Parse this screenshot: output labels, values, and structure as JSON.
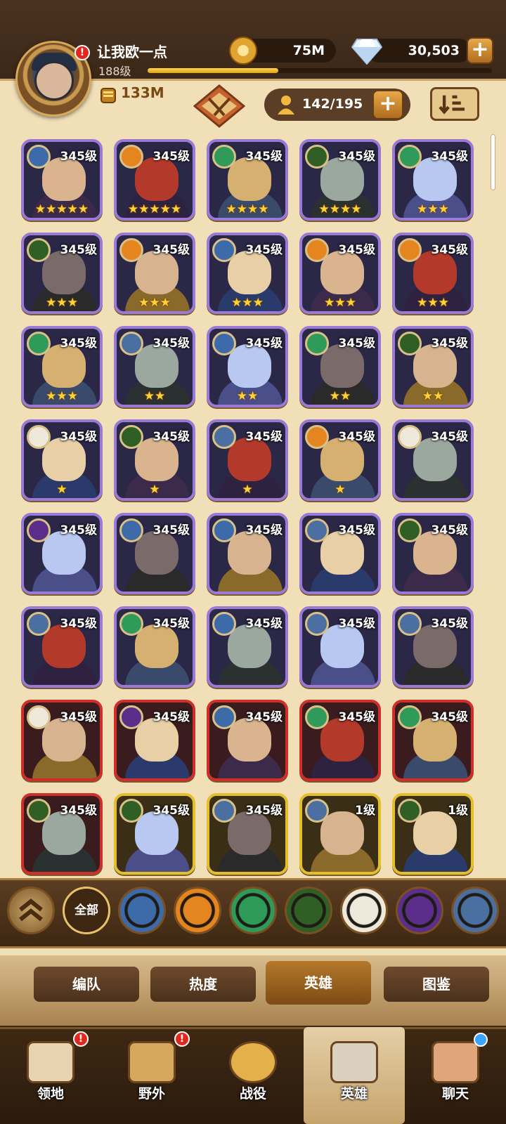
{
  "player": {
    "name": "让我欧一点",
    "level": "188级",
    "power": "133M",
    "xp_progress": 0.38
  },
  "currencies": {
    "gold": "75M",
    "diamonds": "30,503"
  },
  "hero_count": "142/195",
  "colors": {
    "purple_frame": "#9a7ad6",
    "red_frame": "#cf2f2a",
    "gold_frame": "#e3bf2c",
    "star": "#ffd23a"
  },
  "heroes": [
    {
      "level": "345级",
      "stars": "★★★★★",
      "faction": "lightbearer",
      "frame": "purple"
    },
    {
      "level": "345级",
      "stars": "★★★★★",
      "faction": "mauler",
      "frame": "purple"
    },
    {
      "level": "345级",
      "stars": "★★★★",
      "faction": "wilder",
      "frame": "purple"
    },
    {
      "level": "345级",
      "stars": "★★★★",
      "faction": "graveborn",
      "frame": "purple"
    },
    {
      "level": "345级",
      "stars": "★★★",
      "faction": "wilder",
      "frame": "purple"
    },
    {
      "level": "345级",
      "stars": "★★★",
      "faction": "graveborn",
      "frame": "purple"
    },
    {
      "level": "345级",
      "stars": "★★★",
      "faction": "mauler",
      "frame": "purple"
    },
    {
      "level": "345级",
      "stars": "★★★",
      "faction": "lightbearer",
      "frame": "purple"
    },
    {
      "level": "345级",
      "stars": "★★★",
      "faction": "mauler",
      "frame": "purple"
    },
    {
      "level": "345级",
      "stars": "★★★",
      "faction": "mauler",
      "frame": "purple"
    },
    {
      "level": "345级",
      "stars": "★★★",
      "faction": "wilder",
      "frame": "purple"
    },
    {
      "level": "345级",
      "stars": "★★",
      "faction": "dimensional",
      "frame": "purple"
    },
    {
      "level": "345级",
      "stars": "★★",
      "faction": "lightbearer",
      "frame": "purple"
    },
    {
      "level": "345级",
      "stars": "★★",
      "faction": "wilder",
      "frame": "purple"
    },
    {
      "level": "345级",
      "stars": "★★",
      "faction": "graveborn",
      "frame": "purple"
    },
    {
      "level": "345级",
      "stars": "★",
      "faction": "celestial",
      "frame": "purple"
    },
    {
      "level": "345级",
      "stars": "★",
      "faction": "graveborn",
      "frame": "purple"
    },
    {
      "level": "345级",
      "stars": "★",
      "faction": "dimensional",
      "frame": "purple"
    },
    {
      "level": "345级",
      "stars": "★",
      "faction": "mauler",
      "frame": "purple"
    },
    {
      "level": "345级",
      "stars": "",
      "faction": "celestial",
      "frame": "purple"
    },
    {
      "level": "345级",
      "stars": "",
      "faction": "hypogean",
      "frame": "purple"
    },
    {
      "level": "345级",
      "stars": "",
      "faction": "lightbearer",
      "frame": "purple"
    },
    {
      "level": "345级",
      "stars": "",
      "faction": "lightbearer",
      "frame": "purple"
    },
    {
      "level": "345级",
      "stars": "",
      "faction": "dimensional",
      "frame": "purple"
    },
    {
      "level": "345级",
      "stars": "",
      "faction": "graveborn",
      "frame": "purple"
    },
    {
      "level": "345级",
      "stars": "",
      "faction": "dimensional",
      "frame": "purple"
    },
    {
      "level": "345级",
      "stars": "",
      "faction": "wilder",
      "frame": "purple"
    },
    {
      "level": "345级",
      "stars": "",
      "faction": "lightbearer",
      "frame": "purple"
    },
    {
      "level": "345级",
      "stars": "",
      "faction": "dimensional",
      "frame": "purple"
    },
    {
      "level": "345级",
      "stars": "",
      "faction": "dimensional",
      "frame": "purple"
    },
    {
      "level": "345级",
      "stars": "",
      "faction": "celestial",
      "frame": "red"
    },
    {
      "level": "345级",
      "stars": "",
      "faction": "hypogean",
      "frame": "red"
    },
    {
      "level": "345级",
      "stars": "",
      "faction": "lightbearer",
      "frame": "red"
    },
    {
      "level": "345级",
      "stars": "",
      "faction": "wilder",
      "frame": "red"
    },
    {
      "level": "345级",
      "stars": "",
      "faction": "wilder",
      "frame": "red"
    },
    {
      "level": "345级",
      "stars": "",
      "faction": "graveborn",
      "frame": "red"
    },
    {
      "level": "345级",
      "stars": "",
      "faction": "graveborn",
      "frame": "gold"
    },
    {
      "level": "345级",
      "stars": "",
      "faction": "dimensional",
      "frame": "gold"
    },
    {
      "level": "1级",
      "stars": "",
      "faction": "dimensional",
      "frame": "gold"
    },
    {
      "level": "1级",
      "stars": "",
      "faction": "graveborn",
      "frame": "gold"
    }
  ],
  "filters": [
    {
      "label": "",
      "icon": "collapse-up-icon"
    },
    {
      "label": "全部",
      "icon": "all-factions"
    },
    {
      "label": "",
      "icon": "lightbearer-icon",
      "color": "#3d6aa8"
    },
    {
      "label": "",
      "icon": "mauler-icon",
      "color": "#e5851f"
    },
    {
      "label": "",
      "icon": "wilder-icon",
      "color": "#2f9a5a"
    },
    {
      "label": "",
      "icon": "graveborn-icon",
      "color": "#2f5f25"
    },
    {
      "label": "",
      "icon": "celestial-icon",
      "color": "#efe9dc"
    },
    {
      "label": "",
      "icon": "hypogean-icon",
      "color": "#5a2e8a"
    },
    {
      "label": "",
      "icon": "dimensional-icon",
      "color": "#4a6fa0"
    }
  ],
  "subtabs": [
    "编队",
    "热度",
    "英雄",
    "图鉴"
  ],
  "nav": [
    {
      "label": "领地",
      "icon": "castle-icon",
      "badge": "!"
    },
    {
      "label": "野外",
      "icon": "scroll-map-icon",
      "badge": "!"
    },
    {
      "label": "战役",
      "icon": "battle-sword-icon"
    },
    {
      "label": "英雄",
      "icon": "hero-helmet-icon"
    },
    {
      "label": "聊天",
      "icon": "chat-icon"
    }
  ],
  "notifications": {
    "avatar": "!"
  }
}
